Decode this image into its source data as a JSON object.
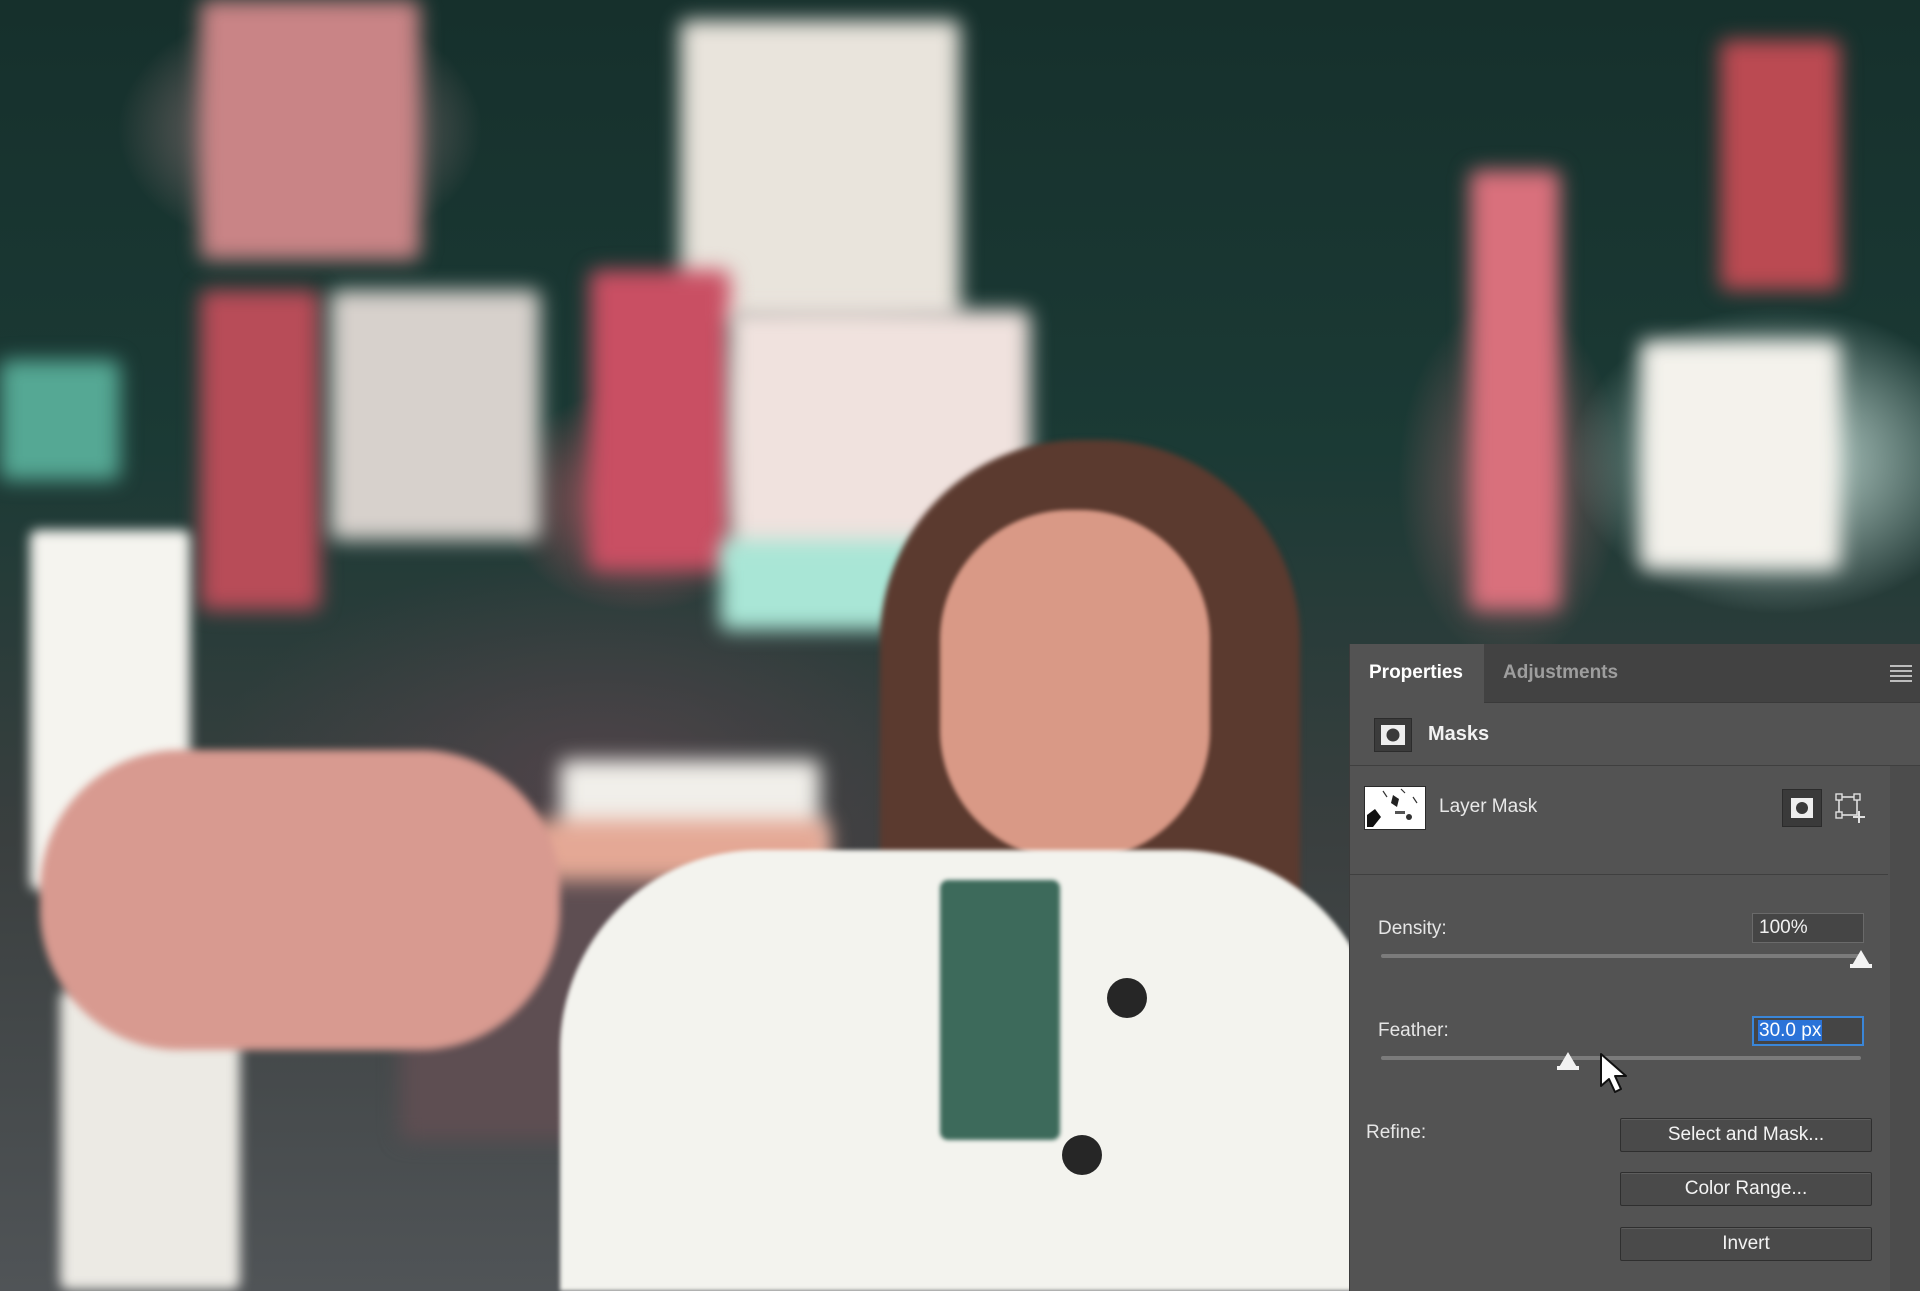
{
  "panel": {
    "tabs": [
      {
        "label": "Properties",
        "active": true
      },
      {
        "label": "Adjustments",
        "active": false
      }
    ],
    "section_title": "Masks",
    "layer_mask": {
      "name": "Layer Mask"
    },
    "density": {
      "label": "Density:",
      "value": "100%",
      "percent": 100
    },
    "feather": {
      "label": "Feather:",
      "value": "30.0 px",
      "slider_fraction": 0.39,
      "selected": true
    },
    "refine": {
      "label": "Refine:",
      "buttons": [
        "Select and Mask...",
        "Color Range...",
        "Invert"
      ]
    }
  },
  "icons": {
    "panel_menu": "hamburger-menu-icon",
    "masks": "pixel-mask-icon",
    "vector_mask": "add-vector-mask-icon",
    "cursor": "mouse-pointer-icon"
  },
  "colors": {
    "panel_bg": "#535353",
    "tabbar_bg": "#424242",
    "selection_blue": "#2b73d8",
    "focus_border": "#3a86d8"
  }
}
